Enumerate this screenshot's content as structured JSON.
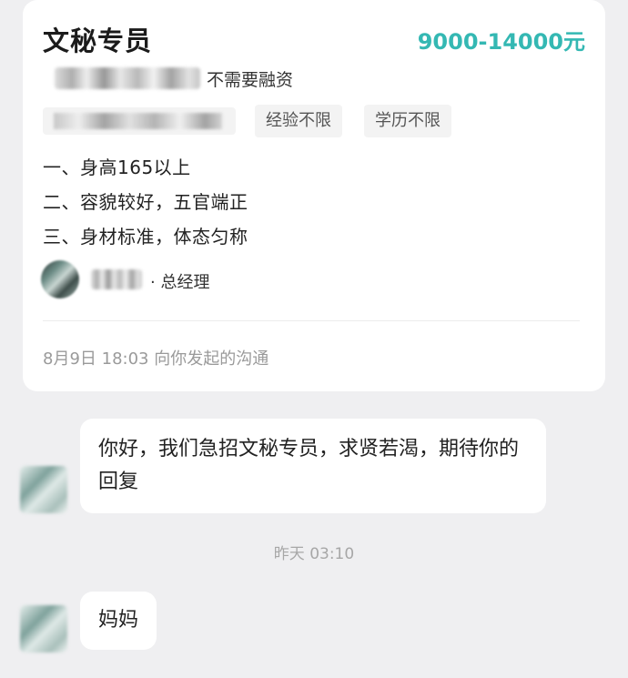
{
  "job": {
    "title": "文秘专员",
    "salary": "9000-14000元",
    "funding": "不需要融资",
    "tags": {
      "experience": "经验不限",
      "education": "学历不限"
    },
    "requirements": [
      "一、身高165以上",
      "二、容貌较好，五官端正",
      "三、身材标准，体态匀称"
    ],
    "recruiter_role": "· 总经理",
    "footer": "8月9日 18:03 向你发起的沟通"
  },
  "chat": {
    "messages": [
      {
        "text": "你好，我们急招文秘专员，求贤若渴，期待你的回复"
      },
      {
        "text": "妈妈"
      }
    ],
    "separator_time": "昨天 03:10"
  },
  "colors": {
    "salary": "#34b8b3",
    "background": "#efeff1"
  }
}
